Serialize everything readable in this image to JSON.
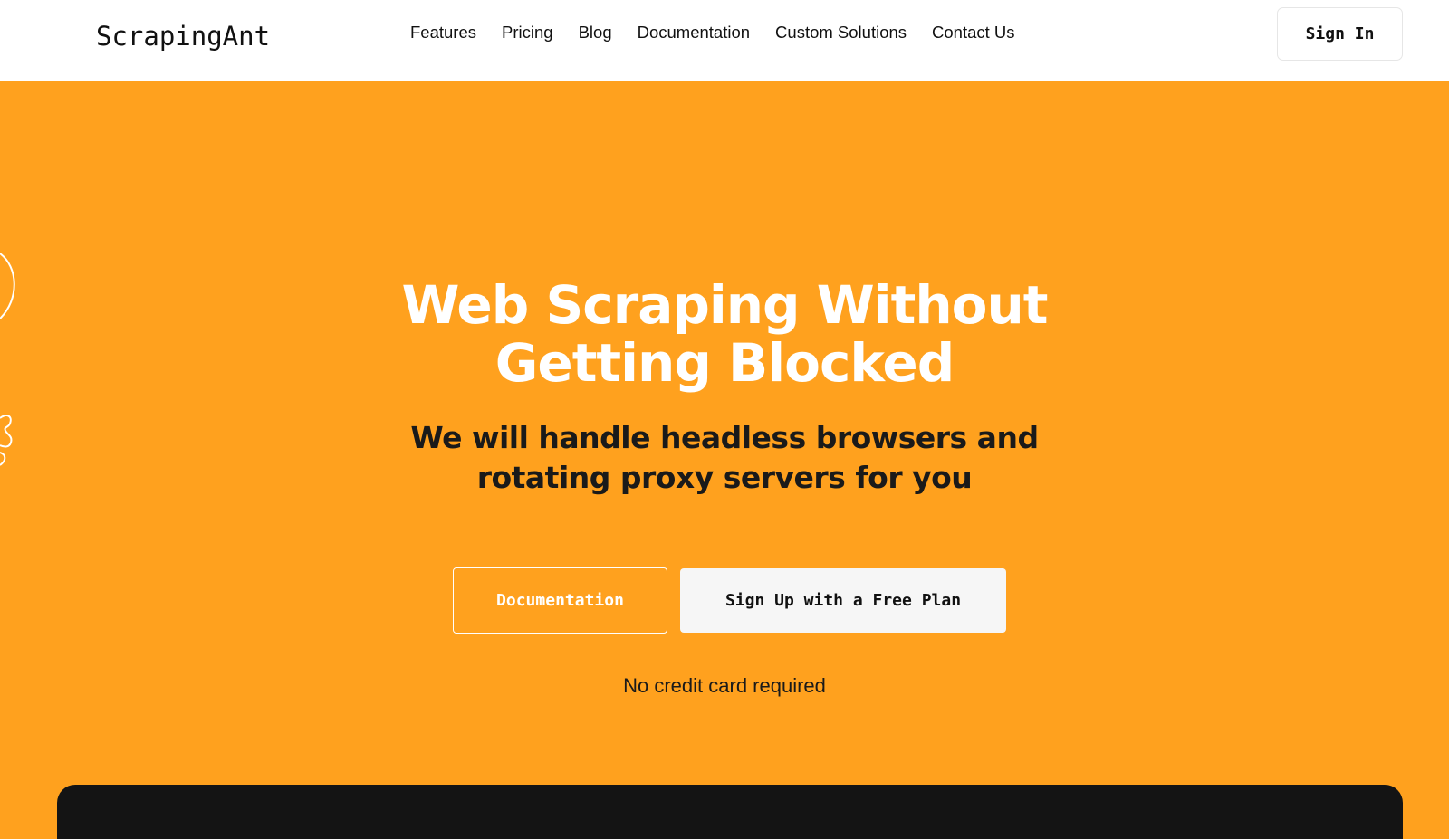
{
  "header": {
    "logo": "ScrapingAnt",
    "nav": [
      {
        "label": "Features"
      },
      {
        "label": "Pricing"
      },
      {
        "label": "Blog"
      },
      {
        "label": "Documentation"
      },
      {
        "label": "Custom Solutions"
      },
      {
        "label": "Contact Us"
      }
    ],
    "sign_in_label": "Sign In"
  },
  "hero": {
    "title_line1": "Web Scraping Without",
    "title_line2": "Getting Blocked",
    "subtitle_line1": "We will handle headless browsers and",
    "subtitle_line2": "rotating proxy servers for you",
    "docs_button_label": "Documentation",
    "signup_button_label": "Sign Up with a Free Plan",
    "note": "No credit card required"
  },
  "colors": {
    "hero_background": "#FFA11E",
    "header_background": "#FFFFFF",
    "dark_panel": "#141414",
    "title_text": "#FFFFFF",
    "body_text": "#1A1A1A"
  },
  "icons": {
    "left_decoration": "ant-outline-decoration"
  }
}
